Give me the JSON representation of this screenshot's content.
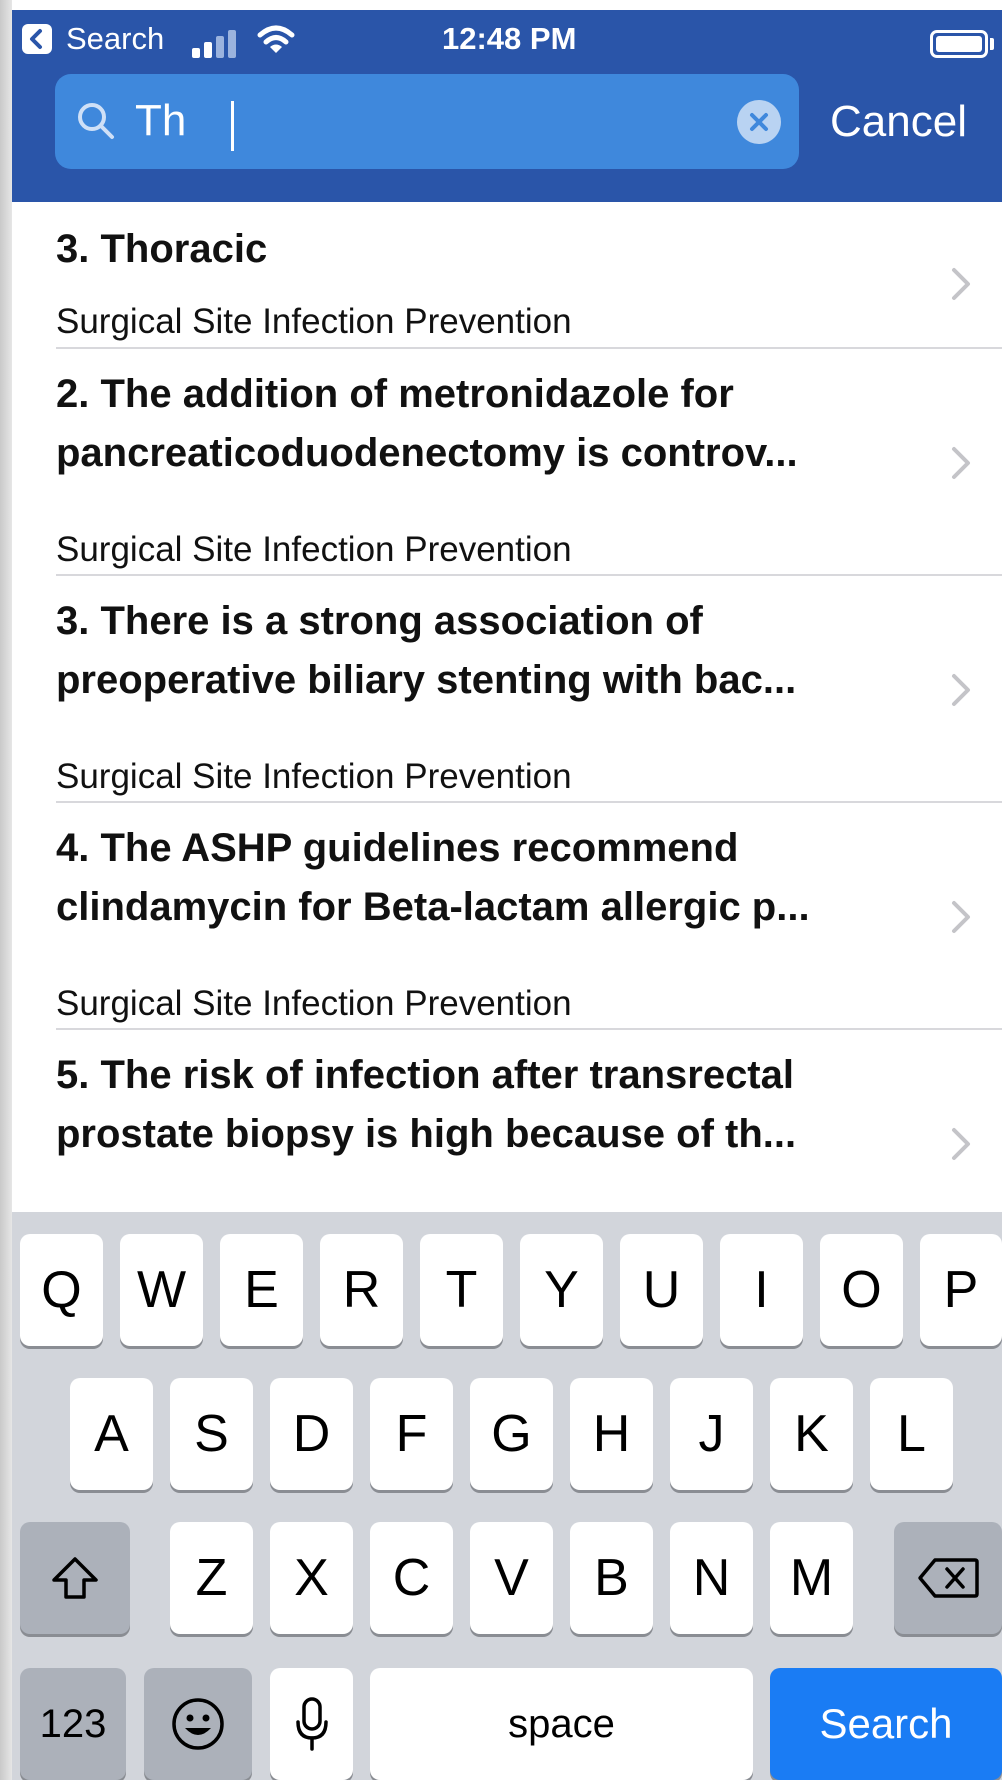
{
  "status_bar": {
    "back_app": "Search",
    "time": "12:48 PM"
  },
  "search": {
    "query": "Th",
    "placeholder": "Search",
    "cancel_label": "Cancel"
  },
  "results": [
    {
      "title": "3. Thoracic",
      "subtitle": "Surgical Site Infection Prevention"
    },
    {
      "title": "2. The addition of metronidazole for\npancreaticoduodenectomy is controv...",
      "subtitle": "Surgical Site Infection Prevention"
    },
    {
      "title": "3. There is a strong association of\npreoperative biliary stenting with bac...",
      "subtitle": "Surgical Site Infection Prevention"
    },
    {
      "title": "4. The ASHP guidelines recommend\nclindamycin for Beta-lactam allergic p...",
      "subtitle": "Surgical Site Infection Prevention"
    },
    {
      "title": "5. The risk of infection after transrectal\nprostate biopsy is high because of th...",
      "subtitle": ""
    }
  ],
  "keyboard": {
    "row1": [
      "Q",
      "W",
      "E",
      "R",
      "T",
      "Y",
      "U",
      "I",
      "O",
      "P"
    ],
    "row2": [
      "A",
      "S",
      "D",
      "F",
      "G",
      "H",
      "J",
      "K",
      "L"
    ],
    "row3": [
      "Z",
      "X",
      "C",
      "V",
      "B",
      "N",
      "M"
    ],
    "numbers_label": "123",
    "space_label": "space",
    "search_label": "Search"
  },
  "colors": {
    "header_bg": "#2a55a9",
    "search_field_bg": "#3f88dc",
    "keyboard_bg": "#d2d5db",
    "search_key_bg": "#1a7cf4"
  }
}
